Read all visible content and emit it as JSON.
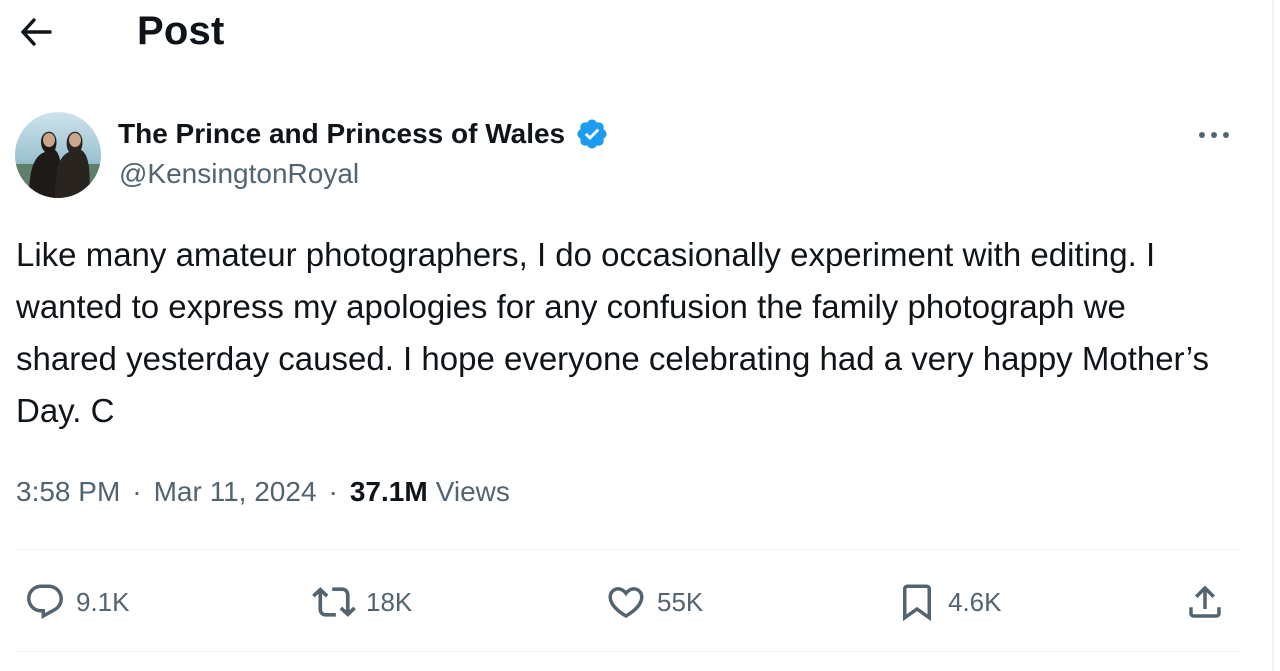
{
  "header": {
    "title": "Post",
    "back_icon": "arrow-left-icon"
  },
  "author": {
    "name": "The Prince and Princess of Wales",
    "handle": "@KensingtonRoyal",
    "verified": true,
    "verified_color": "#1d9bf0"
  },
  "post": {
    "text": "Like many amateur photographers, I do occasionally experiment with editing. I wanted to express my apologies for any confusion the family photograph we shared yesterday caused. I hope everyone celebrating had a very happy Mother’s Day. C",
    "time": "3:58 PM",
    "date": "Mar 11, 2024",
    "views_count": "37.1M",
    "views_label": "Views"
  },
  "actions": {
    "replies": "9.1K",
    "reposts": "18K",
    "likes": "55K",
    "bookmarks": "4.6K"
  },
  "colors": {
    "text_primary": "#0f1419",
    "text_secondary": "#536471",
    "divider": "#eff3f4"
  }
}
